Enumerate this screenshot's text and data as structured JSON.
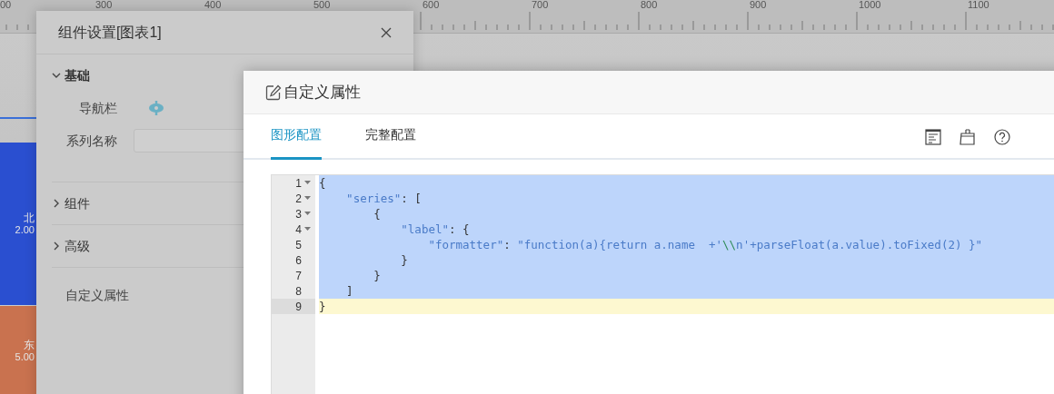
{
  "ruler": {
    "labels": [
      "00",
      "300",
      "400",
      "500",
      "600",
      "700",
      "800",
      "900",
      "1000",
      "1100"
    ]
  },
  "chart": {
    "bars": [
      {
        "name": "北",
        "value": "2.00",
        "color": "#2a4fd0"
      },
      {
        "name": "东",
        "value": "5.00",
        "color": "#c9724f"
      }
    ]
  },
  "settings_dialog": {
    "title": "组件设置[图表1]",
    "sections": [
      {
        "label": "基础",
        "expanded": true,
        "fields": [
          {
            "kind": "toggle",
            "label": "导航栏"
          },
          {
            "kind": "input",
            "label": "系列名称"
          }
        ]
      },
      {
        "label": "组件",
        "expanded": false
      },
      {
        "label": "高级",
        "expanded": false
      }
    ],
    "footer_item": "自定义属性"
  },
  "custom_dialog": {
    "title": "自定义属性",
    "tabs": [
      {
        "label": "图形配置",
        "selected": true
      },
      {
        "label": "完整配置",
        "selected": false
      }
    ],
    "editor": {
      "lines": [
        {
          "number": "1",
          "foldable": true,
          "selected": true,
          "current": false,
          "tokens": [
            {
              "kind": "punct",
              "text": "{"
            }
          ]
        },
        {
          "number": "2",
          "foldable": true,
          "selected": true,
          "current": false,
          "tokens": [
            {
              "kind": "key",
              "text": "    \"series\""
            },
            {
              "kind": "punct",
              "text": ": ["
            }
          ]
        },
        {
          "number": "3",
          "foldable": true,
          "selected": true,
          "current": false,
          "tokens": [
            {
              "kind": "punct",
              "text": "        {"
            }
          ]
        },
        {
          "number": "4",
          "foldable": true,
          "selected": true,
          "current": false,
          "tokens": [
            {
              "kind": "key",
              "text": "            \"label\""
            },
            {
              "kind": "punct",
              "text": ": {"
            }
          ]
        },
        {
          "number": "5",
          "foldable": false,
          "selected": true,
          "current": false,
          "tokens": [
            {
              "kind": "key",
              "text": "                \"formatter\""
            },
            {
              "kind": "punct",
              "text": ": "
            },
            {
              "kind": "string",
              "text": "\"function(a){return a.name  +'"
            },
            {
              "kind": "escape",
              "text": "\\\\"
            },
            {
              "kind": "string",
              "text": "n'+parseFloat(a.value).toFixed(2) }\""
            }
          ]
        },
        {
          "number": "6",
          "foldable": false,
          "selected": true,
          "current": false,
          "tokens": [
            {
              "kind": "punct",
              "text": "            }"
            }
          ]
        },
        {
          "number": "7",
          "foldable": false,
          "selected": true,
          "current": false,
          "tokens": [
            {
              "kind": "punct",
              "text": "        }"
            }
          ]
        },
        {
          "number": "8",
          "foldable": false,
          "selected": true,
          "current": false,
          "tokens": [
            {
              "kind": "punct",
              "text": "    ]"
            }
          ]
        },
        {
          "number": "9",
          "foldable": false,
          "selected": false,
          "current": true,
          "tokens": [
            {
              "kind": "punct",
              "text": "}"
            }
          ]
        }
      ]
    }
  }
}
